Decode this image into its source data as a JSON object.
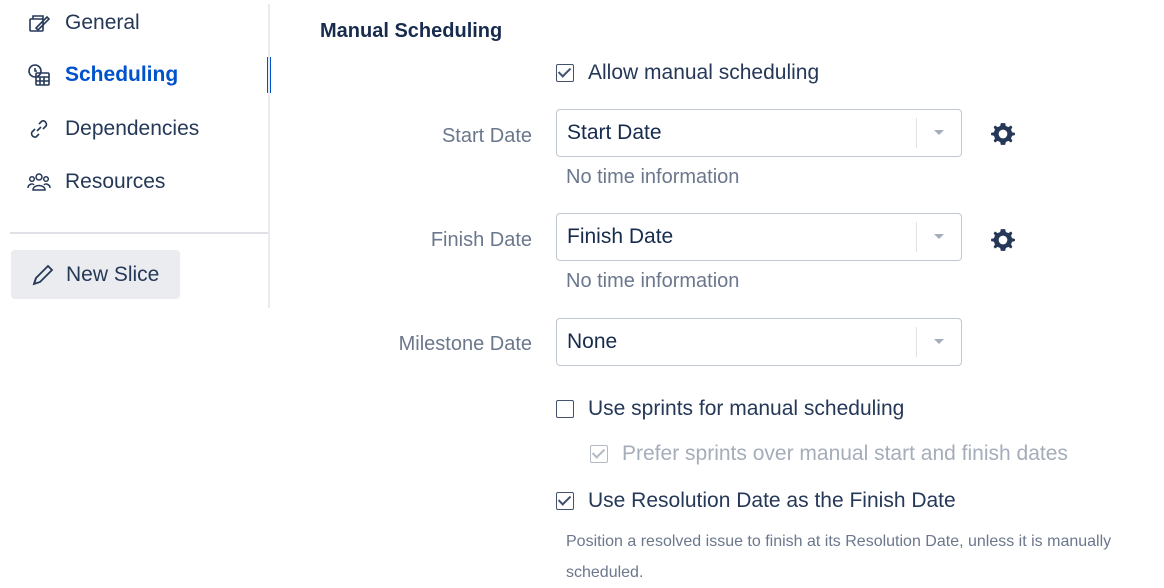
{
  "sidebar": {
    "items": [
      {
        "label": "General",
        "icon": "edit-form-icon"
      },
      {
        "label": "Scheduling",
        "icon": "calendar-clock-icon",
        "active": true
      },
      {
        "label": "Dependencies",
        "icon": "link-icon"
      },
      {
        "label": "Resources",
        "icon": "people-icon"
      }
    ],
    "new_slice_label": "New Slice"
  },
  "main": {
    "section_title": "Manual Scheduling",
    "allow_manual_label": "Allow manual scheduling",
    "start_date": {
      "label": "Start Date",
      "value": "Start Date",
      "hint": "No time information"
    },
    "finish_date": {
      "label": "Finish Date",
      "value": "Finish Date",
      "hint": "No time information"
    },
    "milestone_date": {
      "label": "Milestone Date",
      "value": "None"
    },
    "use_sprints_label": "Use sprints for manual scheduling",
    "prefer_sprints_label": "Prefer sprints over manual start and finish dates",
    "use_resolution_label": "Use Resolution Date as the Finish Date",
    "resolution_desc": "Position a resolved issue to finish at its Resolution Date, unless it is manually scheduled."
  },
  "colors": {
    "accent": "#0052cc",
    "text": "#172b4d",
    "muted": "#6b778c"
  }
}
